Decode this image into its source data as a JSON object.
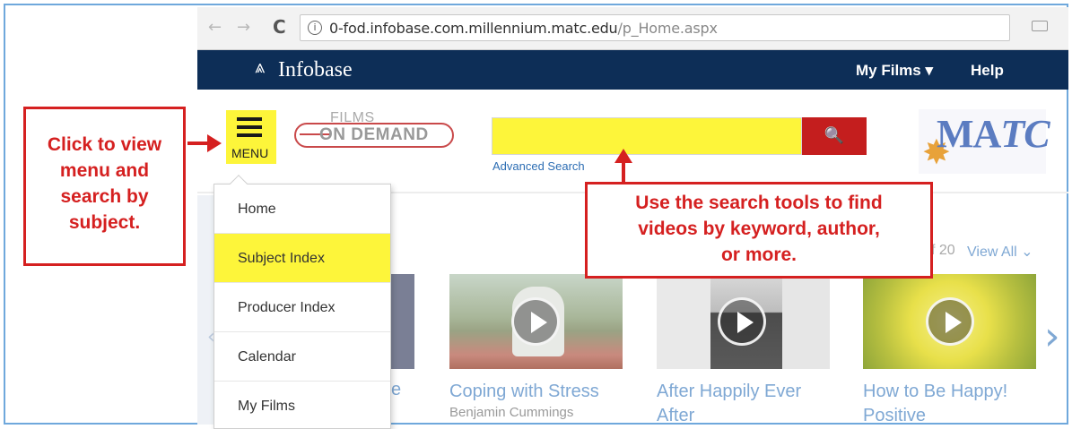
{
  "browser": {
    "back_icon": "←",
    "forward_icon": "→",
    "reload_icon": "C",
    "info_icon": "i",
    "url_host": "0-fod.infobase.com.millennium.matc.edu",
    "url_path": "/p_Home.aspx",
    "key_icon": "⚲",
    "star_icon": "☆"
  },
  "site_header": {
    "logo_mark": "⩓",
    "logo_text": "Infobase",
    "my_films": "My Films ▾",
    "help": "Help"
  },
  "brand_row": {
    "menu_label": "MENU",
    "fod_top": "FILMS",
    "fod_bottom": "ON DEMAND",
    "search_placeholder": "",
    "search_icon": "🔍",
    "advanced_search": "Advanced Search",
    "matc_ma": "MA",
    "matc_tc": "TC",
    "matc_star": "✸"
  },
  "menu": {
    "items": [
      {
        "label": "Home",
        "active": false
      },
      {
        "label": "Subject Index",
        "active": true
      },
      {
        "label": "Producer Index",
        "active": false
      },
      {
        "label": "Calendar",
        "active": false
      },
      {
        "label": "My Films",
        "active": false
      }
    ]
  },
  "carousel": {
    "page_count": "f 20",
    "view_all": "View All ⌄",
    "partial_title": "e",
    "prev_icon": "‹",
    "next_icon": "›",
    "videos": [
      {
        "title": "Coping with Stress",
        "author": "Benjamin Cummings",
        "title2": ""
      },
      {
        "title": "After Happily Ever",
        "author": "",
        "title2": "After"
      },
      {
        "title": "How to Be Happy!",
        "author": "",
        "title2": "Positive"
      }
    ]
  },
  "callouts": {
    "left": [
      "Click to view",
      "menu and",
      "search by",
      "subject."
    ],
    "right": [
      "Use the search tools to find",
      "videos by keyword, author,",
      "or more."
    ]
  },
  "colors": {
    "header_navy": "#0d2e57",
    "highlight_yellow": "#fdf53a",
    "search_red": "#c41e1e",
    "callout_red": "#d52020",
    "link_blue": "#7fa8d4"
  }
}
